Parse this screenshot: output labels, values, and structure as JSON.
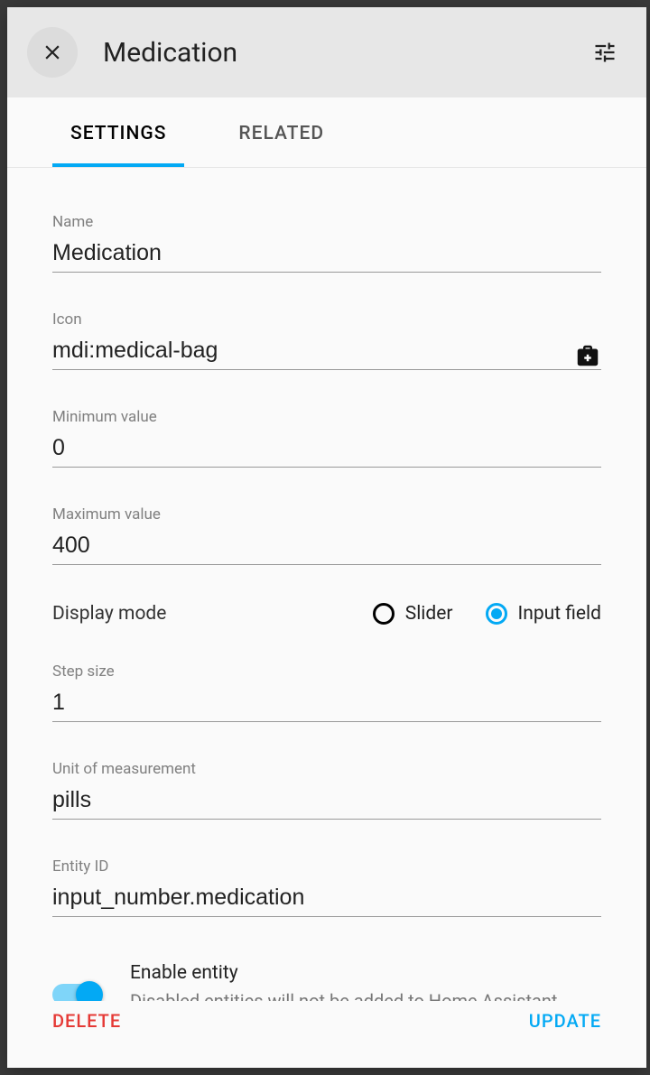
{
  "header": {
    "title": "Medication"
  },
  "tabs": {
    "settings": "SETTINGS",
    "related": "RELATED"
  },
  "fields": {
    "name": {
      "label": "Name",
      "value": "Medication"
    },
    "icon": {
      "label": "Icon",
      "value": "mdi:medical-bag"
    },
    "min": {
      "label": "Minimum value",
      "value": "0"
    },
    "max": {
      "label": "Maximum value",
      "value": "400"
    },
    "display_mode": {
      "label": "Display mode",
      "options": {
        "slider": "Slider",
        "input_field": "Input field"
      },
      "selected": "input_field"
    },
    "step": {
      "label": "Step size",
      "value": "1"
    },
    "unit": {
      "label": "Unit of measurement",
      "value": "pills"
    },
    "entity_id": {
      "label": "Entity ID",
      "value": "input_number.medication"
    },
    "enable": {
      "title": "Enable entity",
      "description": "Disabled entities will not be added to Home Assistant. Note: this might not work yet with all integrations."
    }
  },
  "footer": {
    "delete": "DELETE",
    "update": "UPDATE"
  }
}
